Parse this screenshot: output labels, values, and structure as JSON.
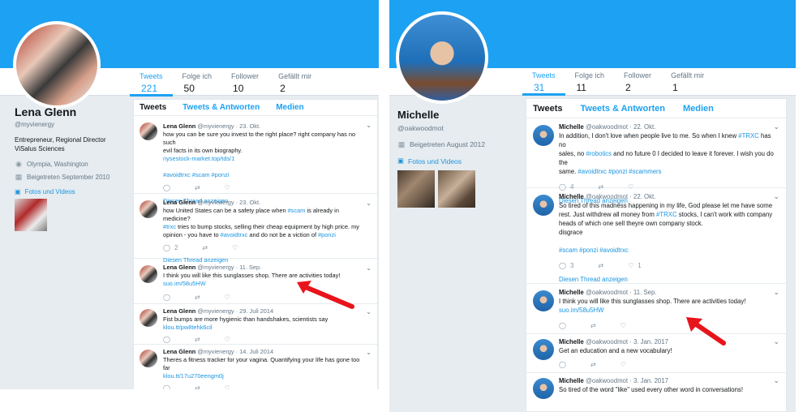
{
  "left": {
    "profile": {
      "name": "Lena Glenn",
      "handle": "@myvienergy",
      "bio": "Entrepreneur, Regional Director ViSalus Sciences",
      "location": "Olympia, Washington",
      "joined": "Beigetreten September 2010",
      "photos_label": "Fotos und Videos"
    },
    "stats": [
      {
        "label": "Tweets",
        "value": "221"
      },
      {
        "label": "Folge ich",
        "value": "50"
      },
      {
        "label": "Follower",
        "value": "10"
      },
      {
        "label": "Gefällt mir",
        "value": "2"
      }
    ],
    "tabs": [
      "Tweets",
      "Tweets & Antworten",
      "Medien"
    ],
    "tweets": [
      {
        "name": "Lena Glenn",
        "handle": "@myvienergy",
        "date": "· 23. Okt.",
        "line1": "how you can be sure you invest to the right place? right company has no such",
        "line2": "evil facts in its own biography.",
        "line3": "nysestock-market.top/tds/1",
        "line4": "#avoidtrxc #scam #ponzi",
        "reply": "",
        "retweet": "",
        "like": "",
        "thread": "Diesen Thread anzeigen"
      },
      {
        "name": "Lena Glenn",
        "handle": "@myvienergy",
        "date": "· 23. Okt.",
        "line1a": "how United States can be a safety place when ",
        "line1b": "#scam",
        "line1c": " is already in medicine?",
        "line2a": "#trxc",
        "line2b": " tries to bump stocks, selling their cheap equipment by high price. my",
        "line3a": "opinion - you have to ",
        "line3b": "#avoidtrxc",
        "line3c": " and do not be a viction of ",
        "line3d": "#ponzi",
        "reply": "2",
        "retweet": "",
        "like": "",
        "thread": "Diesen Thread anzeigen"
      },
      {
        "name": "Lena Glenn",
        "handle": "@myvienergy",
        "date": "· 11. Sep.",
        "line1": "I think you will like this sunglasses shop. There are activities today!",
        "line2": "suo.im/58u5HW",
        "reply": "",
        "retweet": "",
        "like": ""
      },
      {
        "name": "Lena Glenn",
        "handle": "@myvienergy",
        "date": "· 29. Juli 2014",
        "line1": "Fist bumps are more hygienic than handshakes, scientists say",
        "line2": "klou.tt/pw8tehk6cil",
        "reply": "",
        "retweet": "",
        "like": ""
      },
      {
        "name": "Lena Glenn",
        "handle": "@myvienergy",
        "date": "· 14. Juli 2014",
        "line1": "Theres a fitness tracker for your vagina. Quantifying your life has gone too far",
        "line2": "klou.tt/17u270eengm0j",
        "reply": "",
        "retweet": "",
        "like": ""
      }
    ]
  },
  "right": {
    "profile": {
      "name": "Michelle",
      "handle": "@oakwoodmot",
      "joined": "Beigetreten August 2012",
      "photos_label": "Fotos und Videos"
    },
    "stats": [
      {
        "label": "Tweets",
        "value": "31"
      },
      {
        "label": "Folge ich",
        "value": "11"
      },
      {
        "label": "Follower",
        "value": "2"
      },
      {
        "label": "Gefällt mir",
        "value": "1"
      }
    ],
    "tabs": [
      "Tweets",
      "Tweets & Antworten",
      "Medien"
    ],
    "tweets": [
      {
        "name": "Michelle",
        "handle": "@oakwoodmot",
        "date": "· 22. Okt.",
        "line1a": "In addition, I don't love when people live to me. So when I knew ",
        "line1b": "#TRXC",
        "line1c": " has no",
        "line2a": "sales, no ",
        "line2b": "#robotics",
        "line2c": " and no future 0 I decided to leave it forever. I wish you do the",
        "line3a": "same. ",
        "line3b": "#avoidtrxc #ponzi #scammers",
        "reply": "4",
        "retweet": "",
        "like": "",
        "thread": "Diesen Thread anzeigen"
      },
      {
        "name": "Michelle",
        "handle": "@oakwoodmot",
        "date": "· 22. Okt.",
        "line1": "So tired of this madness happening in my life, God please let me have some",
        "line2a": "rest. Just withdrew all money from ",
        "line2b": "#TRXC",
        "line2c": " stocks, I can't work with company",
        "line3": "heads of which one sell theyre own company stock.",
        "line4": "disgrace",
        "line5": "#scam #ponzi #avoidtrxc",
        "reply": "3",
        "retweet": "",
        "like": "1",
        "thread": "Diesen Thread anzeigen"
      },
      {
        "name": "Michelle",
        "handle": "@oakwoodmot",
        "date": "· 11. Sep.",
        "line1": "I think you will like this sunglasses shop. There are activities today!",
        "line2": "suo.im/58u5HW",
        "reply": "",
        "retweet": "",
        "like": ""
      },
      {
        "name": "Michelle",
        "handle": "@oakwoodmot",
        "date": "· 3. Jan. 2017",
        "line1": "Get an education and a new vocabulary!",
        "reply": "",
        "retweet": "",
        "like": ""
      },
      {
        "name": "Michelle",
        "handle": "@oakwoodmot",
        "date": "· 3. Jan. 2017",
        "line1": "So tired of the word \"like\" used every other word in conversations!"
      }
    ]
  },
  "colors": {
    "brand": "#1da1f2",
    "link": "#1b95e0",
    "annotation_arrow": "#e8141b"
  }
}
